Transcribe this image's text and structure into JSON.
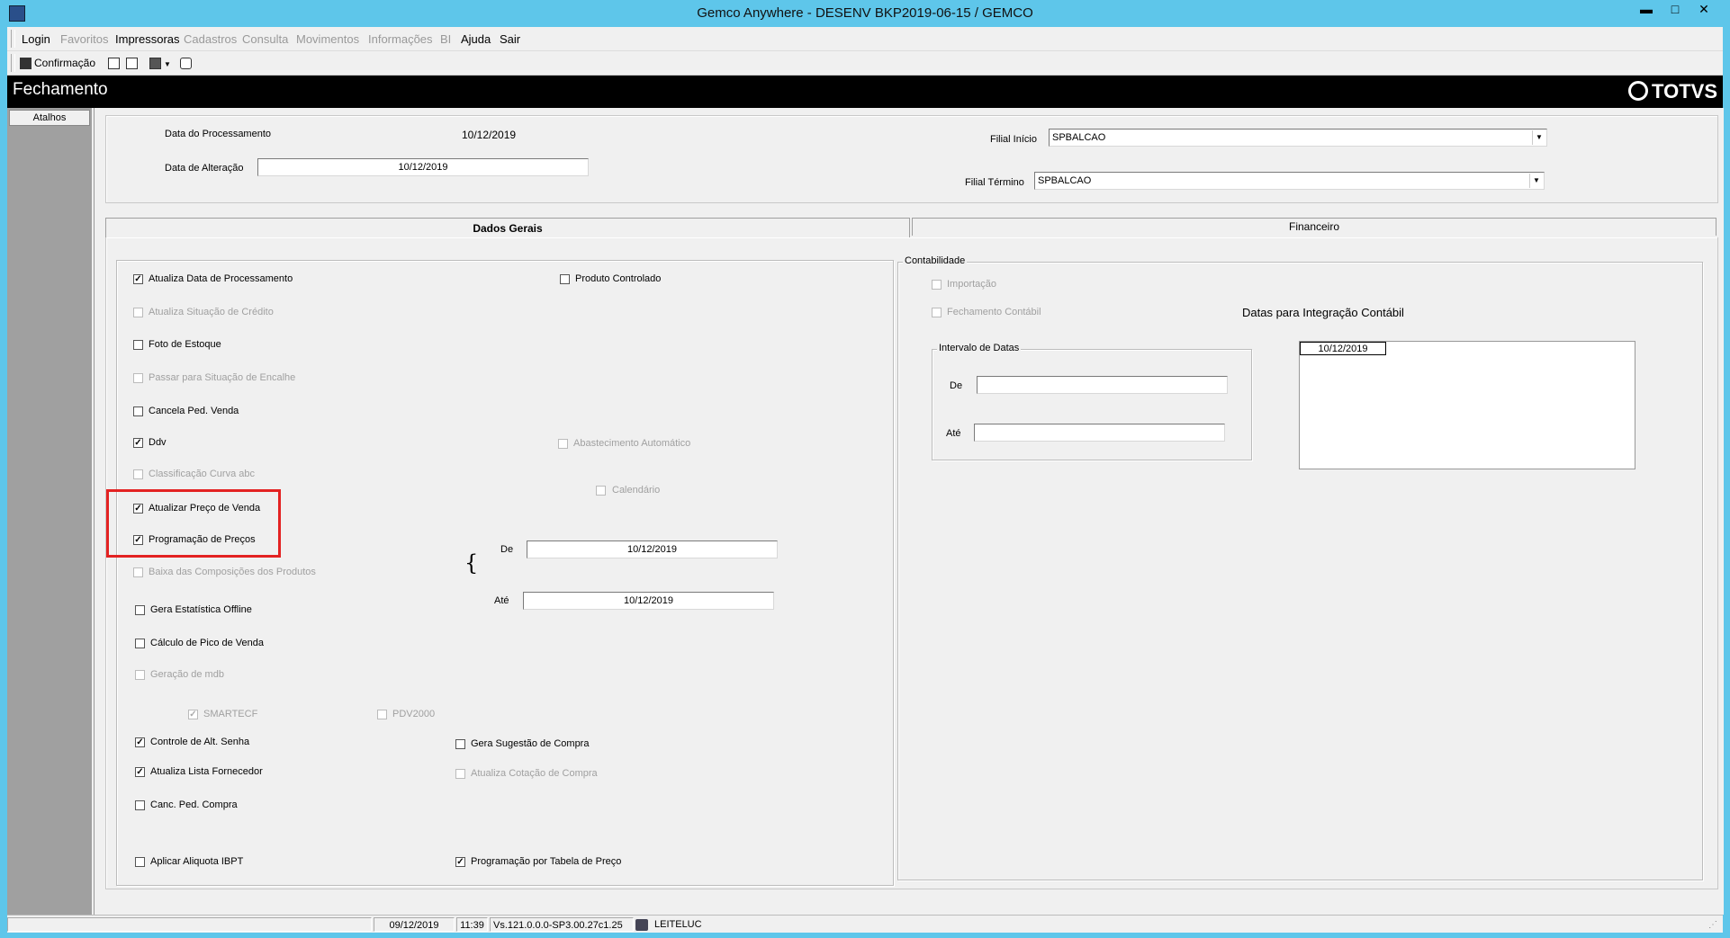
{
  "window": {
    "title": "Gemco Anywhere - DESENV BKP2019-06-15 / GEMCO",
    "minimize": "▬",
    "maximize": "□",
    "close": "✕"
  },
  "menu": [
    {
      "label": "Login",
      "enabled": true
    },
    {
      "label": "Favoritos",
      "enabled": false
    },
    {
      "label": "Impressoras",
      "enabled": true
    },
    {
      "label": "Cadastros",
      "enabled": false
    },
    {
      "label": "Consulta",
      "enabled": false
    },
    {
      "label": "Movimentos",
      "enabled": false
    },
    {
      "label": "Informações",
      "enabled": false
    },
    {
      "label": "BI",
      "enabled": false
    },
    {
      "label": "Ajuda",
      "enabled": true
    },
    {
      "label": "Sair",
      "enabled": true
    }
  ],
  "toolbar": {
    "confirm_label": "Confirmação"
  },
  "header": {
    "title": "Fechamento",
    "logo": "TOTVS"
  },
  "sidebar": {
    "atalhos": "Atalhos"
  },
  "top_form": {
    "data_processamento_label": "Data do Processamento",
    "data_processamento_value": "10/12/2019",
    "data_alteracao_label": "Data de Alteração",
    "data_alteracao_value": "10/12/2019",
    "filial_inicio_label": "Filial Início",
    "filial_inicio_value": "SPBALCAO",
    "filial_termino_label": "Filial Término",
    "filial_termino_value": "SPBALCAO"
  },
  "tabs": {
    "dados_gerais": "Dados Gerais",
    "financeiro": "Financeiro"
  },
  "checks": {
    "atualiza_data": {
      "label": "Atualiza Data de Processamento",
      "checked": true,
      "enabled": true
    },
    "produto_controlado": {
      "label": "Produto Controlado",
      "checked": false,
      "enabled": true
    },
    "atualiza_situacao": {
      "label": "Atualiza Situação de Crédito",
      "checked": false,
      "enabled": false
    },
    "foto_estoque": {
      "label": "Foto de Estoque",
      "checked": false,
      "enabled": true
    },
    "passar_encalhe": {
      "label": "Passar para Situação de Encalhe",
      "checked": false,
      "enabled": false
    },
    "cancela_ped_venda": {
      "label": "Cancela Ped. Venda",
      "checked": false,
      "enabled": true
    },
    "ddv": {
      "label": "Ddv",
      "checked": true,
      "enabled": true
    },
    "abastecimento": {
      "label": "Abastecimento Automático",
      "checked": false,
      "enabled": false
    },
    "classificacao_abc": {
      "label": "Classificação Curva abc",
      "checked": false,
      "enabled": false
    },
    "calendario": {
      "label": "Calendário",
      "checked": false,
      "enabled": false
    },
    "atualizar_preco": {
      "label": "Atualizar Preço de Venda",
      "checked": true,
      "enabled": true
    },
    "programacao_precos": {
      "label": "Programação de Preços",
      "checked": true,
      "enabled": true
    },
    "baixa_composicoes": {
      "label": "Baixa das Composições dos Produtos",
      "checked": false,
      "enabled": false
    },
    "gera_estatistica": {
      "label": "Gera Estatística Offline",
      "checked": false,
      "enabled": true
    },
    "calculo_pico": {
      "label": "Cálculo de Pico de Venda",
      "checked": false,
      "enabled": true
    },
    "geracao_mdb": {
      "label": "Geração de mdb",
      "checked": false,
      "enabled": false
    },
    "smartecf": {
      "label": "SMARTECF",
      "checked": true,
      "enabled": false
    },
    "pdv2000": {
      "label": "PDV2000",
      "checked": false,
      "enabled": false
    },
    "controle_senha": {
      "label": "Controle de Alt. Senha",
      "checked": true,
      "enabled": true
    },
    "gera_sugestao": {
      "label": "Gera Sugestão de Compra",
      "checked": false,
      "enabled": true
    },
    "atualiza_fornecedor": {
      "label": "Atualiza Lista Fornecedor",
      "checked": true,
      "enabled": true
    },
    "atualiza_cotacao": {
      "label": "Atualiza Cotação de Compra",
      "checked": false,
      "enabled": false
    },
    "canc_ped_compra": {
      "label": "Canc. Ped. Compra",
      "checked": false,
      "enabled": true
    },
    "aplicar_ibpt": {
      "label": "Aplicar Aliquota IBPT",
      "checked": false,
      "enabled": true
    },
    "programacao_tabela": {
      "label": "Programação por Tabela de Preço",
      "checked": true,
      "enabled": true
    }
  },
  "prog_range": {
    "de_label": "De",
    "de_value": "10/12/2019",
    "ate_label": "Até",
    "ate_value": "10/12/2019"
  },
  "contabilidade": {
    "title": "Contabilidade",
    "importacao": {
      "label": "Importação",
      "checked": false,
      "enabled": false
    },
    "fechamento_contabil": {
      "label": "Fechamento Contábil",
      "checked": false,
      "enabled": false
    },
    "datas_integracao_label": "Datas para Integração Contábil",
    "datas_list": [
      "10/12/2019"
    ],
    "intervalo_title": "Intervalo de Datas",
    "de_label": "De",
    "de_value": "",
    "ate_label": "Até",
    "ate_value": ""
  },
  "statusbar": {
    "date": "09/12/2019",
    "time": "11:39",
    "version": "Vs.121.0.0.0-SP3.00.27c1.25",
    "user": "LEITELUC"
  }
}
